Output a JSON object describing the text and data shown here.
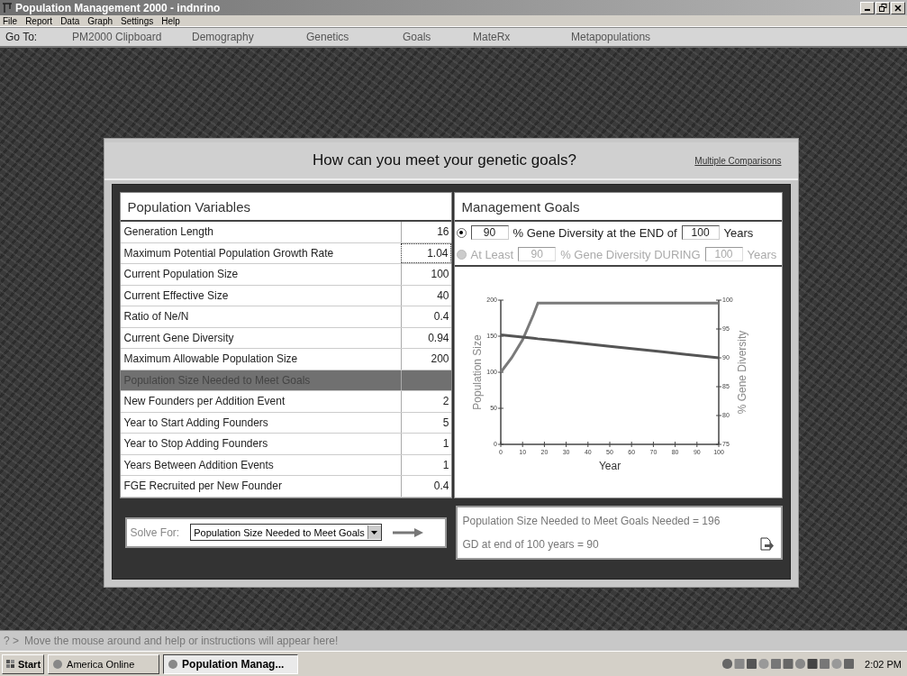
{
  "window": {
    "title": "Population Management 2000 - indnrino"
  },
  "menu": [
    "File",
    "Report",
    "Data",
    "Graph",
    "Settings",
    "Help"
  ],
  "goto": {
    "label": "Go To:",
    "items": [
      "PM2000 Clipboard",
      "Demography",
      "Genetics",
      "Goals",
      "MateRx",
      "Metapopulations"
    ]
  },
  "panel": {
    "title": "How can you meet your genetic goals?",
    "link": "Multiple Comparisons"
  },
  "variables": {
    "title": "Population Variables",
    "rows": [
      {
        "label": "Generation Length",
        "value": "16",
        "selected": false,
        "focused": false
      },
      {
        "label": "Maximum Potential Population Growth Rate",
        "value": "1.04",
        "selected": false,
        "focused": true
      },
      {
        "label": "Current Population Size",
        "value": "100",
        "selected": false,
        "focused": false
      },
      {
        "label": "Current Effective Size",
        "value": "40",
        "selected": false,
        "focused": false
      },
      {
        "label": "Ratio of Ne/N",
        "value": "0.4",
        "selected": false,
        "focused": false
      },
      {
        "label": "Current Gene Diversity",
        "value": "0.94",
        "selected": false,
        "focused": false
      },
      {
        "label": "Maximum Allowable Population Size",
        "value": "200",
        "selected": false,
        "focused": false
      },
      {
        "label": "Population Size Needed to Meet Goals",
        "selected": true,
        "focused": false
      },
      {
        "label": "New Founders per Addition Event",
        "value": "2",
        "selected": false,
        "focused": false
      },
      {
        "label": "Year to Start Adding Founders",
        "value": "5",
        "selected": false,
        "focused": false
      },
      {
        "label": "Year to Stop Adding Founders",
        "value": "1",
        "selected": false,
        "focused": false
      },
      {
        "label": "Years Between  Addition Events",
        "value": "1",
        "selected": false,
        "focused": false
      },
      {
        "label": "FGE Recruited per New Founder",
        "value": "0.4",
        "selected": false,
        "focused": false
      }
    ]
  },
  "goals": {
    "title": "Management Goals",
    "options": [
      {
        "selected": true,
        "disabled": false,
        "parts": [
          {
            "kind": "field",
            "text": "90"
          },
          {
            "kind": "text",
            "text": "% Gene Diversity at the END of"
          },
          {
            "kind": "field",
            "text": "100"
          },
          {
            "kind": "text",
            "text": "Years"
          }
        ]
      },
      {
        "selected": false,
        "disabled": true,
        "parts": [
          {
            "kind": "text",
            "text": "At Least"
          },
          {
            "kind": "field",
            "text": "90"
          },
          {
            "kind": "text",
            "text": "% Gene Diversity DURING"
          },
          {
            "kind": "field",
            "text": "100"
          },
          {
            "kind": "text",
            "text": "Years"
          }
        ]
      }
    ],
    "chart_data": {
      "type": "line",
      "xlabel": "Year",
      "x": [
        0,
        5,
        10,
        15,
        17,
        25,
        50,
        75,
        100
      ],
      "xlim": [
        0,
        100
      ],
      "ylim": [
        0,
        200
      ],
      "y2lim": [
        75,
        100
      ],
      "xticks": [
        0,
        10,
        20,
        30,
        40,
        50,
        60,
        70,
        80,
        90,
        100
      ],
      "yticks": [
        0,
        50,
        100,
        150,
        200
      ],
      "y2ticks": [
        75,
        80,
        85,
        90,
        95,
        100
      ],
      "series": [
        {
          "name": "Population Size",
          "color": "#7a7a7a",
          "axis": "y",
          "values": [
            100,
            120,
            145,
            180,
            196,
            196,
            196,
            196,
            196
          ]
        },
        {
          "name": "% Gene Diversity",
          "color": "#555555",
          "axis": "y2",
          "values": [
            94,
            93.8,
            93.6,
            93.4,
            93.3,
            93,
            92,
            91,
            90
          ]
        }
      ]
    }
  },
  "solve": {
    "label": "Solve For:",
    "value": "Population Size Needed to Meet Goals"
  },
  "results": [
    "Population Size Needed to Meet Goals Needed = 196",
    "GD at end of 100 years = 90"
  ],
  "status_bar": {
    "prompt": "? >",
    "text": "Move the mouse around and help or instructions will appear here!"
  },
  "taskbar": {
    "start": "Start",
    "tasks": [
      {
        "label": "America  Online",
        "selected": false
      },
      {
        "label": "Population Manag...",
        "selected": true
      }
    ],
    "time": "2:02 PM"
  }
}
